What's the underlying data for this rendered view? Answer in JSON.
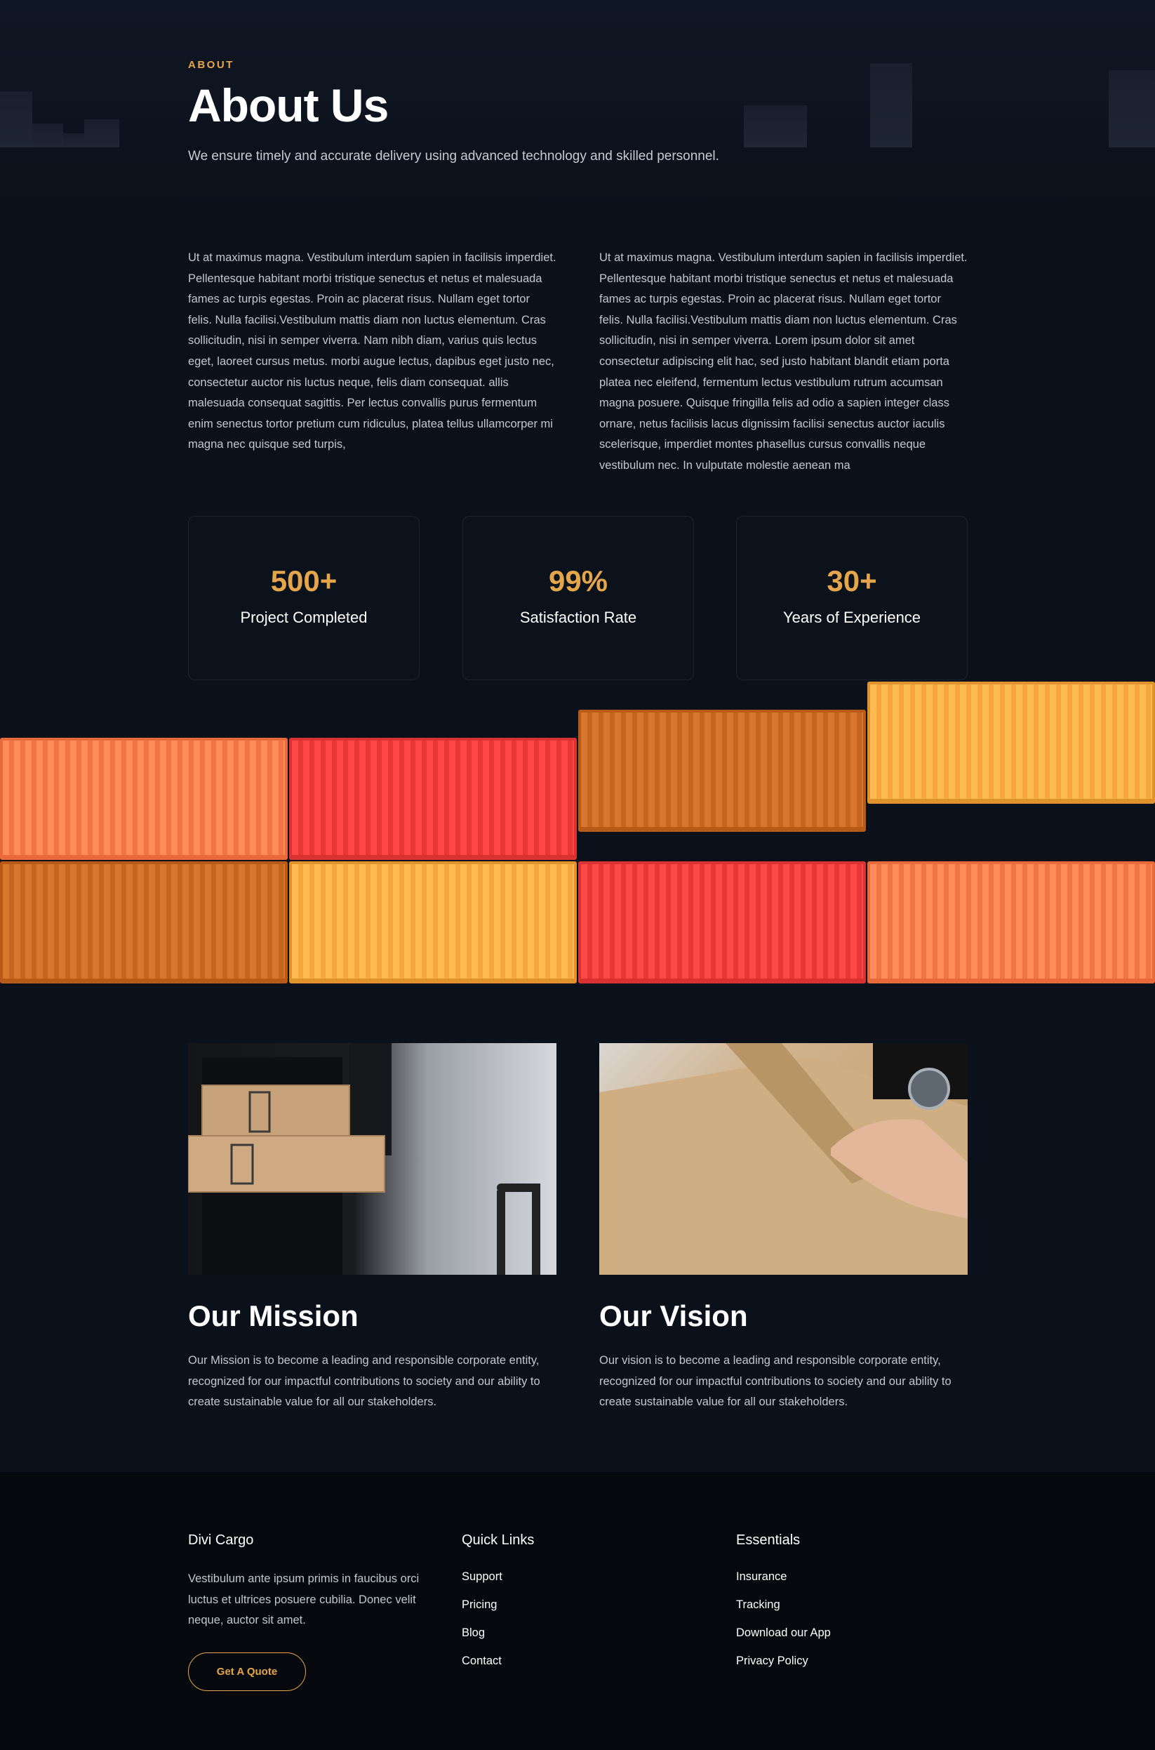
{
  "hero": {
    "eyebrow": "ABOUT",
    "title": "About Us",
    "subtitle": "We ensure timely and accurate delivery using advanced technology and skilled personnel."
  },
  "intro": {
    "left": "Ut at maximus magna. Vestibulum interdum sapien in facilisis imperdiet. Pellentesque habitant morbi tristique senectus et netus et malesuada fames ac turpis egestas. Proin ac placerat risus. Nullam eget tortor felis. Nulla facilisi.Vestibulum mattis diam non luctus elementum. Cras sollicitudin, nisi in semper viverra. Nam nibh diam, varius quis lectus eget, laoreet cursus metus. morbi augue lectus, dapibus eget justo nec, consectetur auctor nis luctus neque, felis diam consequat. allis malesuada consequat sagittis. Per lectus convallis purus fermentum enim senectus tortor pretium cum ridiculus, platea tellus ullamcorper mi magna nec quisque sed turpis,",
    "right": "Ut at maximus magna. Vestibulum interdum sapien in facilisis imperdiet. Pellentesque habitant morbi tristique senectus et netus et malesuada fames ac turpis egestas. Proin ac placerat risus. Nullam eget tortor felis. Nulla facilisi.Vestibulum mattis diam non luctus elementum. Cras sollicitudin, nisi in semper viverra. Lorem ipsum dolor sit amet consectetur adipiscing elit hac, sed justo habitant blandit etiam porta platea nec eleifend, fermentum lectus vestibulum rutrum accumsan magna posuere. Quisque fringilla felis ad odio a sapien integer class ornare, netus facilisis lacus dignissim facilisi senectus auctor iaculis scelerisque, imperdiet montes phasellus cursus convallis neque vestibulum nec. In vulputate molestie aenean ma"
  },
  "stats": [
    {
      "value": "500+",
      "label": "Project Completed"
    },
    {
      "value": "99%",
      "label": "Satisfaction Rate"
    },
    {
      "value": "30+",
      "label": "Years of Experience"
    }
  ],
  "mission": {
    "title": "Our Mission",
    "text": "Our Mission is to become a leading and responsible corporate entity, recognized for our impactful contributions to society and our ability to create sustainable value for all our stakeholders."
  },
  "vision": {
    "title": "Our Vision",
    "text": "Our vision is to become a leading and responsible corporate entity, recognized for our impactful contributions to society and our ability to create sustainable value for all our stakeholders."
  },
  "footer": {
    "brand": {
      "title": "Divi Cargo",
      "text": "Vestibulum ante ipsum primis in faucibus orci luctus et ultrices posuere cubilia. Donec velit neque, auctor sit amet.",
      "button": "Get A Quote"
    },
    "quick_links": {
      "title": "Quick Links",
      "links": [
        "Support",
        "Pricing",
        "Blog",
        "Contact"
      ]
    },
    "essentials": {
      "title": "Essentials",
      "links": [
        "Insurance",
        "Tracking",
        "Download our App",
        "Privacy Policy"
      ]
    }
  },
  "colors": {
    "background": "#0b111b",
    "accent": "#e5a64b",
    "footer_bg": "#05080c"
  }
}
